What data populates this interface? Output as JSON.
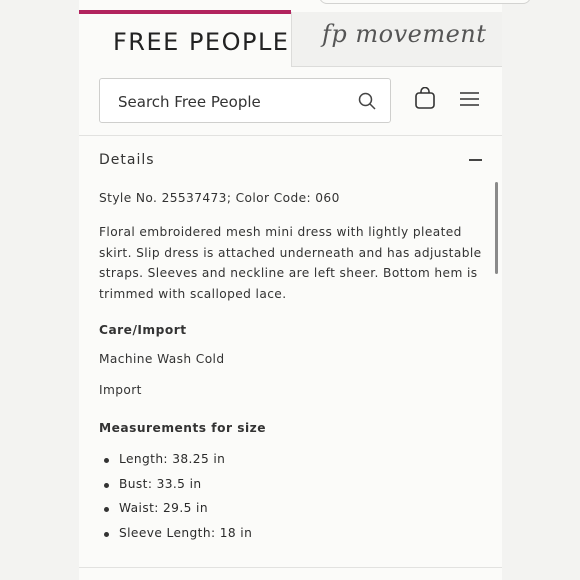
{
  "brand_tabs": {
    "free_people": "FREE PEOPLE",
    "fp_movement": "fp movement"
  },
  "search": {
    "placeholder": "Search Free People",
    "value": ""
  },
  "accent_color": "#b2245e",
  "details": {
    "title": "Details",
    "style_line": "Style No. 25537473; Color Code: 060",
    "description": "Floral embroidered mesh mini dress with lightly pleated skirt. Slip dress is attached underneath and has adjustable straps. Sleeves and neckline are left sheer. Bottom hem is trimmed with scalloped lace.",
    "care_heading": "Care/Import",
    "care_items": [
      "Machine Wash Cold",
      "Import"
    ],
    "measure_heading": "Measurements for size",
    "measurements": [
      "Length: 38.25 in",
      "Bust: 33.5 in",
      "Waist: 29.5 in",
      "Sleeve Length: 18 in"
    ]
  }
}
